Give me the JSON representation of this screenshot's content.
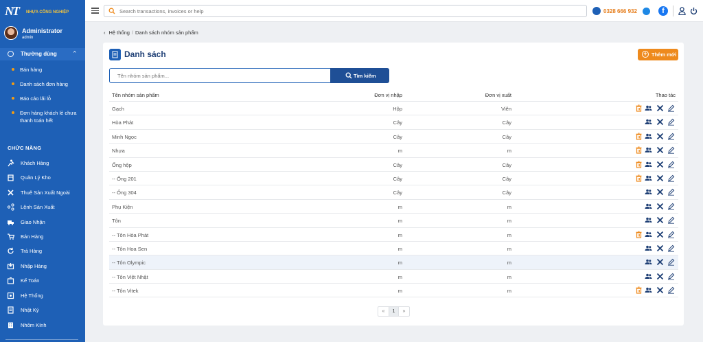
{
  "brand": {
    "logo_text": "NT",
    "tagline": "NHỰA CÔNG NGHIỆP"
  },
  "user": {
    "name": "Administrator",
    "role": "admin"
  },
  "sidebar": {
    "group_label": "Thường dùng",
    "sub_items": [
      {
        "label": "Bán hàng"
      },
      {
        "label": "Danh sách đơn hàng"
      },
      {
        "label": "Báo cáo lãi lỗ"
      },
      {
        "label": "Đơn hàng khách lẻ chưa thanh toán hết"
      }
    ],
    "section_label": "CHỨC NĂNG",
    "items": [
      {
        "label": "Khách Hàng",
        "icon": "runner-icon"
      },
      {
        "label": "Quản Lý Kho",
        "icon": "warehouse-icon"
      },
      {
        "label": "Thuê Sản Xuất Ngoài",
        "icon": "tools-icon"
      },
      {
        "label": "Lệnh Sản Xuất",
        "icon": "share-icon"
      },
      {
        "label": "Giao Nhận",
        "icon": "truck-icon"
      },
      {
        "label": "Bán Hàng",
        "icon": "cart-icon"
      },
      {
        "label": "Trả Hàng",
        "icon": "return-icon"
      },
      {
        "label": "Nhập Hàng",
        "icon": "import-icon"
      },
      {
        "label": "Kế Toán",
        "icon": "accounting-icon"
      },
      {
        "label": "Hệ Thống",
        "icon": "system-icon"
      },
      {
        "label": "Nhật Ký",
        "icon": "journal-icon"
      },
      {
        "label": "Nhôm Kính",
        "icon": "building-icon"
      }
    ]
  },
  "header": {
    "search_placeholder": "Search transactions, invoices or help",
    "phone": "0328 666 932",
    "facebook_letter": "f"
  },
  "breadcrumb": {
    "parent": "Hệ thống",
    "separator": "/",
    "current": "Danh sách nhóm sản phẩm"
  },
  "card": {
    "title": "Danh sách",
    "add_label": "Thêm mới",
    "filter_placeholder": "Tên nhóm sản phẩm...",
    "search_label": "Tìm kiếm"
  },
  "table": {
    "headers": {
      "name": "Tên nhóm sản phẩm",
      "unit_in": "Đơn vị nhập",
      "unit_out": "Đơn vị xuất",
      "actions": "Thao tác"
    },
    "rows": [
      {
        "name": "Gạch",
        "unit_in": "Hộp",
        "unit_out": "Viên",
        "deletable": true,
        "highlight": false
      },
      {
        "name": "Hòa Phát",
        "unit_in": "Cây",
        "unit_out": "Cây",
        "deletable": false,
        "highlight": false
      },
      {
        "name": "Minh Ngọc",
        "unit_in": "Cây",
        "unit_out": "Cây",
        "deletable": true,
        "highlight": false
      },
      {
        "name": "Nhựa",
        "unit_in": "m",
        "unit_out": "m",
        "deletable": true,
        "highlight": false
      },
      {
        "name": "Ống hộp",
        "unit_in": "Cây",
        "unit_out": "Cây",
        "deletable": true,
        "highlight": false
      },
      {
        "name": "-- Ống 201",
        "unit_in": "Cây",
        "unit_out": "Cây",
        "deletable": true,
        "highlight": false
      },
      {
        "name": "-- Ống 304",
        "unit_in": "Cây",
        "unit_out": "Cây",
        "deletable": false,
        "highlight": false
      },
      {
        "name": "Phụ Kiện",
        "unit_in": "m",
        "unit_out": "m",
        "deletable": false,
        "highlight": false
      },
      {
        "name": "Tôn",
        "unit_in": "m",
        "unit_out": "m",
        "deletable": false,
        "highlight": false
      },
      {
        "name": "-- Tôn Hòa Phát",
        "unit_in": "m",
        "unit_out": "m",
        "deletable": true,
        "highlight": false
      },
      {
        "name": "-- Tôn Hoa Sen",
        "unit_in": "m",
        "unit_out": "m",
        "deletable": false,
        "highlight": false
      },
      {
        "name": "-- Tôn Olympic",
        "unit_in": "m",
        "unit_out": "m",
        "deletable": false,
        "highlight": true
      },
      {
        "name": "-- Tôn Việt Nhật",
        "unit_in": "m",
        "unit_out": "m",
        "deletable": false,
        "highlight": false
      },
      {
        "name": "-- Tôn Vitek",
        "unit_in": "m",
        "unit_out": "m",
        "deletable": true,
        "highlight": false
      }
    ]
  },
  "pagination": {
    "prev": "«",
    "current": "1",
    "next": "»"
  },
  "colors": {
    "sidebar": "#1e60b6",
    "accent": "#ee8a1d",
    "primary": "#1f4f96",
    "delete": "#ee8a1d",
    "action": "#1e3f75"
  }
}
